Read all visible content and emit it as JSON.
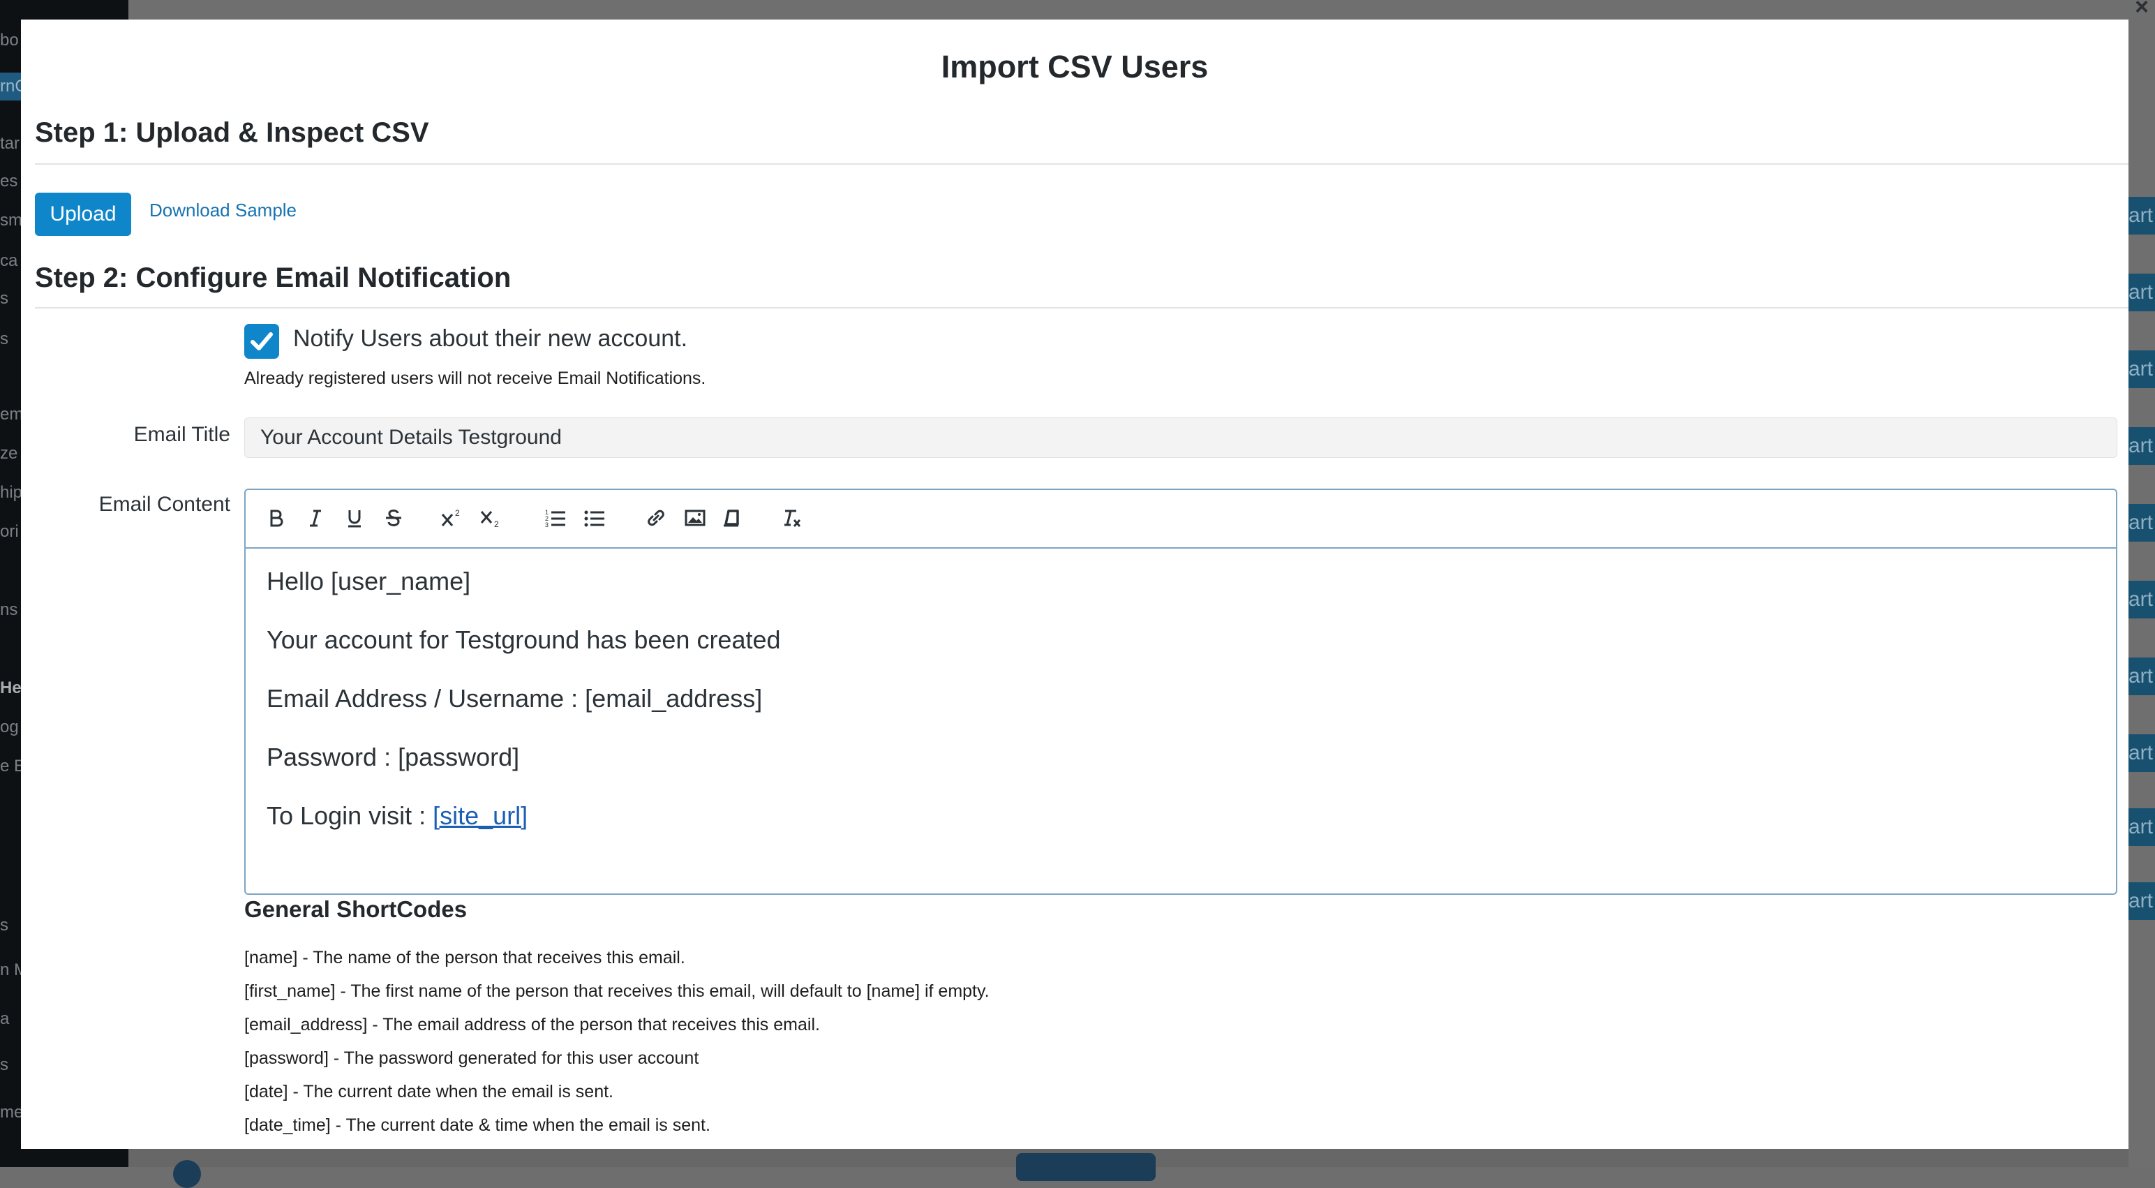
{
  "background": {
    "sidebar_fragments": [
      "bo",
      "rnC",
      "tar",
      "es",
      "sm",
      "ca",
      "s",
      "s",
      "em",
      "ze",
      "hip",
      "ori",
      "ns",
      "He",
      "og",
      "e E",
      "s",
      "n M",
      "a",
      "s",
      "me"
    ],
    "right_tab_fragment": "art"
  },
  "modal": {
    "close_glyph": "×",
    "title": "Import CSV Users",
    "step1": {
      "heading": "Step 1: Upload & Inspect CSV",
      "upload_label": "Upload",
      "download_sample_label": "Download Sample"
    },
    "step2": {
      "heading": "Step 2: Configure Email Notification",
      "notify_checked": true,
      "notify_label": "Notify Users about their new account.",
      "notify_note": "Already registered users will not receive Email Notifications.",
      "email_title_label": "Email Title",
      "email_title_value": "Your Account Details Testground",
      "email_content_label": "Email Content",
      "toolbar": [
        {
          "name": "bold-icon",
          "label": "B"
        },
        {
          "name": "italic-icon",
          "label": "I"
        },
        {
          "name": "underline-icon",
          "label": "U"
        },
        {
          "name": "strikethrough-icon",
          "label": "S"
        },
        {
          "name": "superscript-icon",
          "label": "x²"
        },
        {
          "name": "subscript-icon",
          "label": "x₂"
        },
        {
          "name": "ordered-list-icon",
          "label": "ordered list"
        },
        {
          "name": "bullet-list-icon",
          "label": "bullet list"
        },
        {
          "name": "link-icon",
          "label": "link"
        },
        {
          "name": "image-icon",
          "label": "image"
        },
        {
          "name": "video-icon",
          "label": "video"
        },
        {
          "name": "clear-format-icon",
          "label": "Tx"
        }
      ],
      "email_content_lines": [
        {
          "text": "Hello [user_name]"
        },
        {
          "text": "Your account for Testground has been created"
        },
        {
          "text": "Email Address / Username : [email_address]"
        },
        {
          "text": "Password : [password]"
        },
        {
          "text": "To Login visit : ",
          "link": "[site_url]"
        }
      ],
      "shortcodes_heading": "General ShortCodes",
      "shortcodes": [
        "[name] - The name of the person that receives this email.",
        "[first_name] - The first name of the person that receives this email, will default to [name] if empty.",
        "[email_address] - The email address of the person that receives this email.",
        "[password] - The password generated for this user account",
        "[date] - The current date when the email is sent.",
        "[date_time] - The current date & time when the email is sent."
      ]
    }
  }
}
